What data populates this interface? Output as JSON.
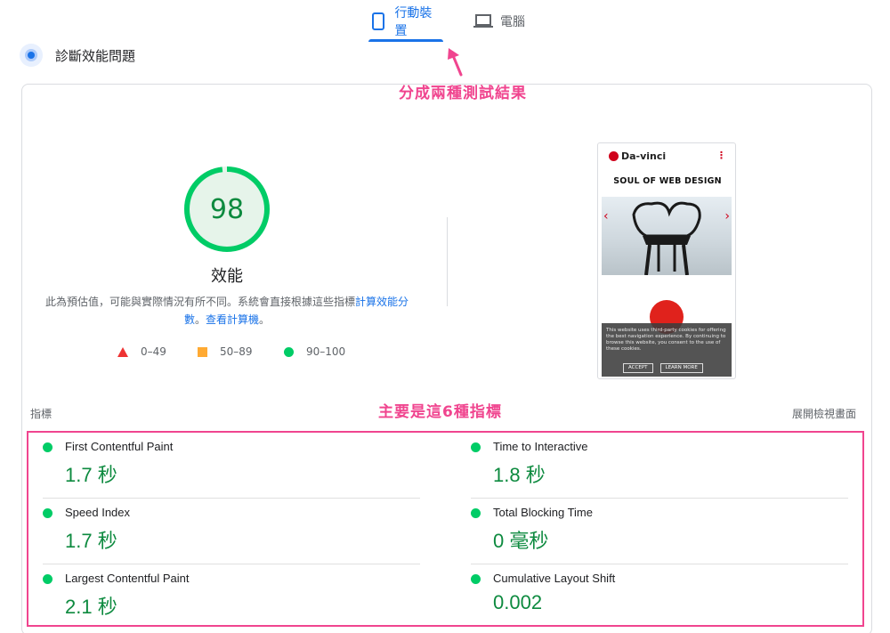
{
  "tabs": [
    {
      "label": "行動裝置",
      "icon": "smartphone-icon",
      "active": true
    },
    {
      "label": "電腦",
      "icon": "laptop-icon",
      "active": false
    }
  ],
  "section": {
    "title": "診斷效能問題",
    "icon": "diagnostic-icon"
  },
  "annotations": {
    "tabs_note": "分成兩種測試結果",
    "metrics_note": "主要是這6種指標"
  },
  "score": {
    "value": 98,
    "fraction": 0.98,
    "label": "效能",
    "description_prefix": "此為預估值，可能與實際情況有所不同。系統會直接根據這些指標",
    "calc_link": "計算效能分數",
    "sep": "。",
    "calculator_link": "查看計算機",
    "suffix": "。",
    "colors": {
      "pass": "#0c6",
      "pass_text": "#0d8a3f",
      "gauge_bg": "#e6f4ea"
    }
  },
  "legend": [
    {
      "range": "0–49",
      "shape": "triangle",
      "color": "#ff3333"
    },
    {
      "range": "50–89",
      "shape": "square",
      "color": "#ffaa33"
    },
    {
      "range": "90–100",
      "shape": "circle",
      "color": "#00cc66"
    }
  ],
  "screenshot": {
    "brand": "Da-vinci",
    "headline": "SOUL OF WEB DESIGN",
    "cookie_text": "This website uses third-party cookies for offering the best navigation experience. By continuing to browse this website, you consent to the use of these cookies.",
    "accept": "ACCEPT",
    "learn_more": "LEARN MORE"
  },
  "metrics_header": {
    "label": "指標",
    "expand": "展開檢視畫面"
  },
  "metrics": [
    {
      "name": "First Contentful Paint",
      "value": "1.7 秒",
      "status": "pass"
    },
    {
      "name": "Time to Interactive",
      "value": "1.8 秒",
      "status": "pass"
    },
    {
      "name": "Speed Index",
      "value": "1.7 秒",
      "status": "pass"
    },
    {
      "name": "Total Blocking Time",
      "value": "0 毫秒",
      "status": "pass"
    },
    {
      "name": "Largest Contentful Paint",
      "value": "2.1 秒",
      "status": "pass"
    },
    {
      "name": "Cumulative Layout Shift",
      "value": "0.002",
      "status": "pass"
    }
  ]
}
